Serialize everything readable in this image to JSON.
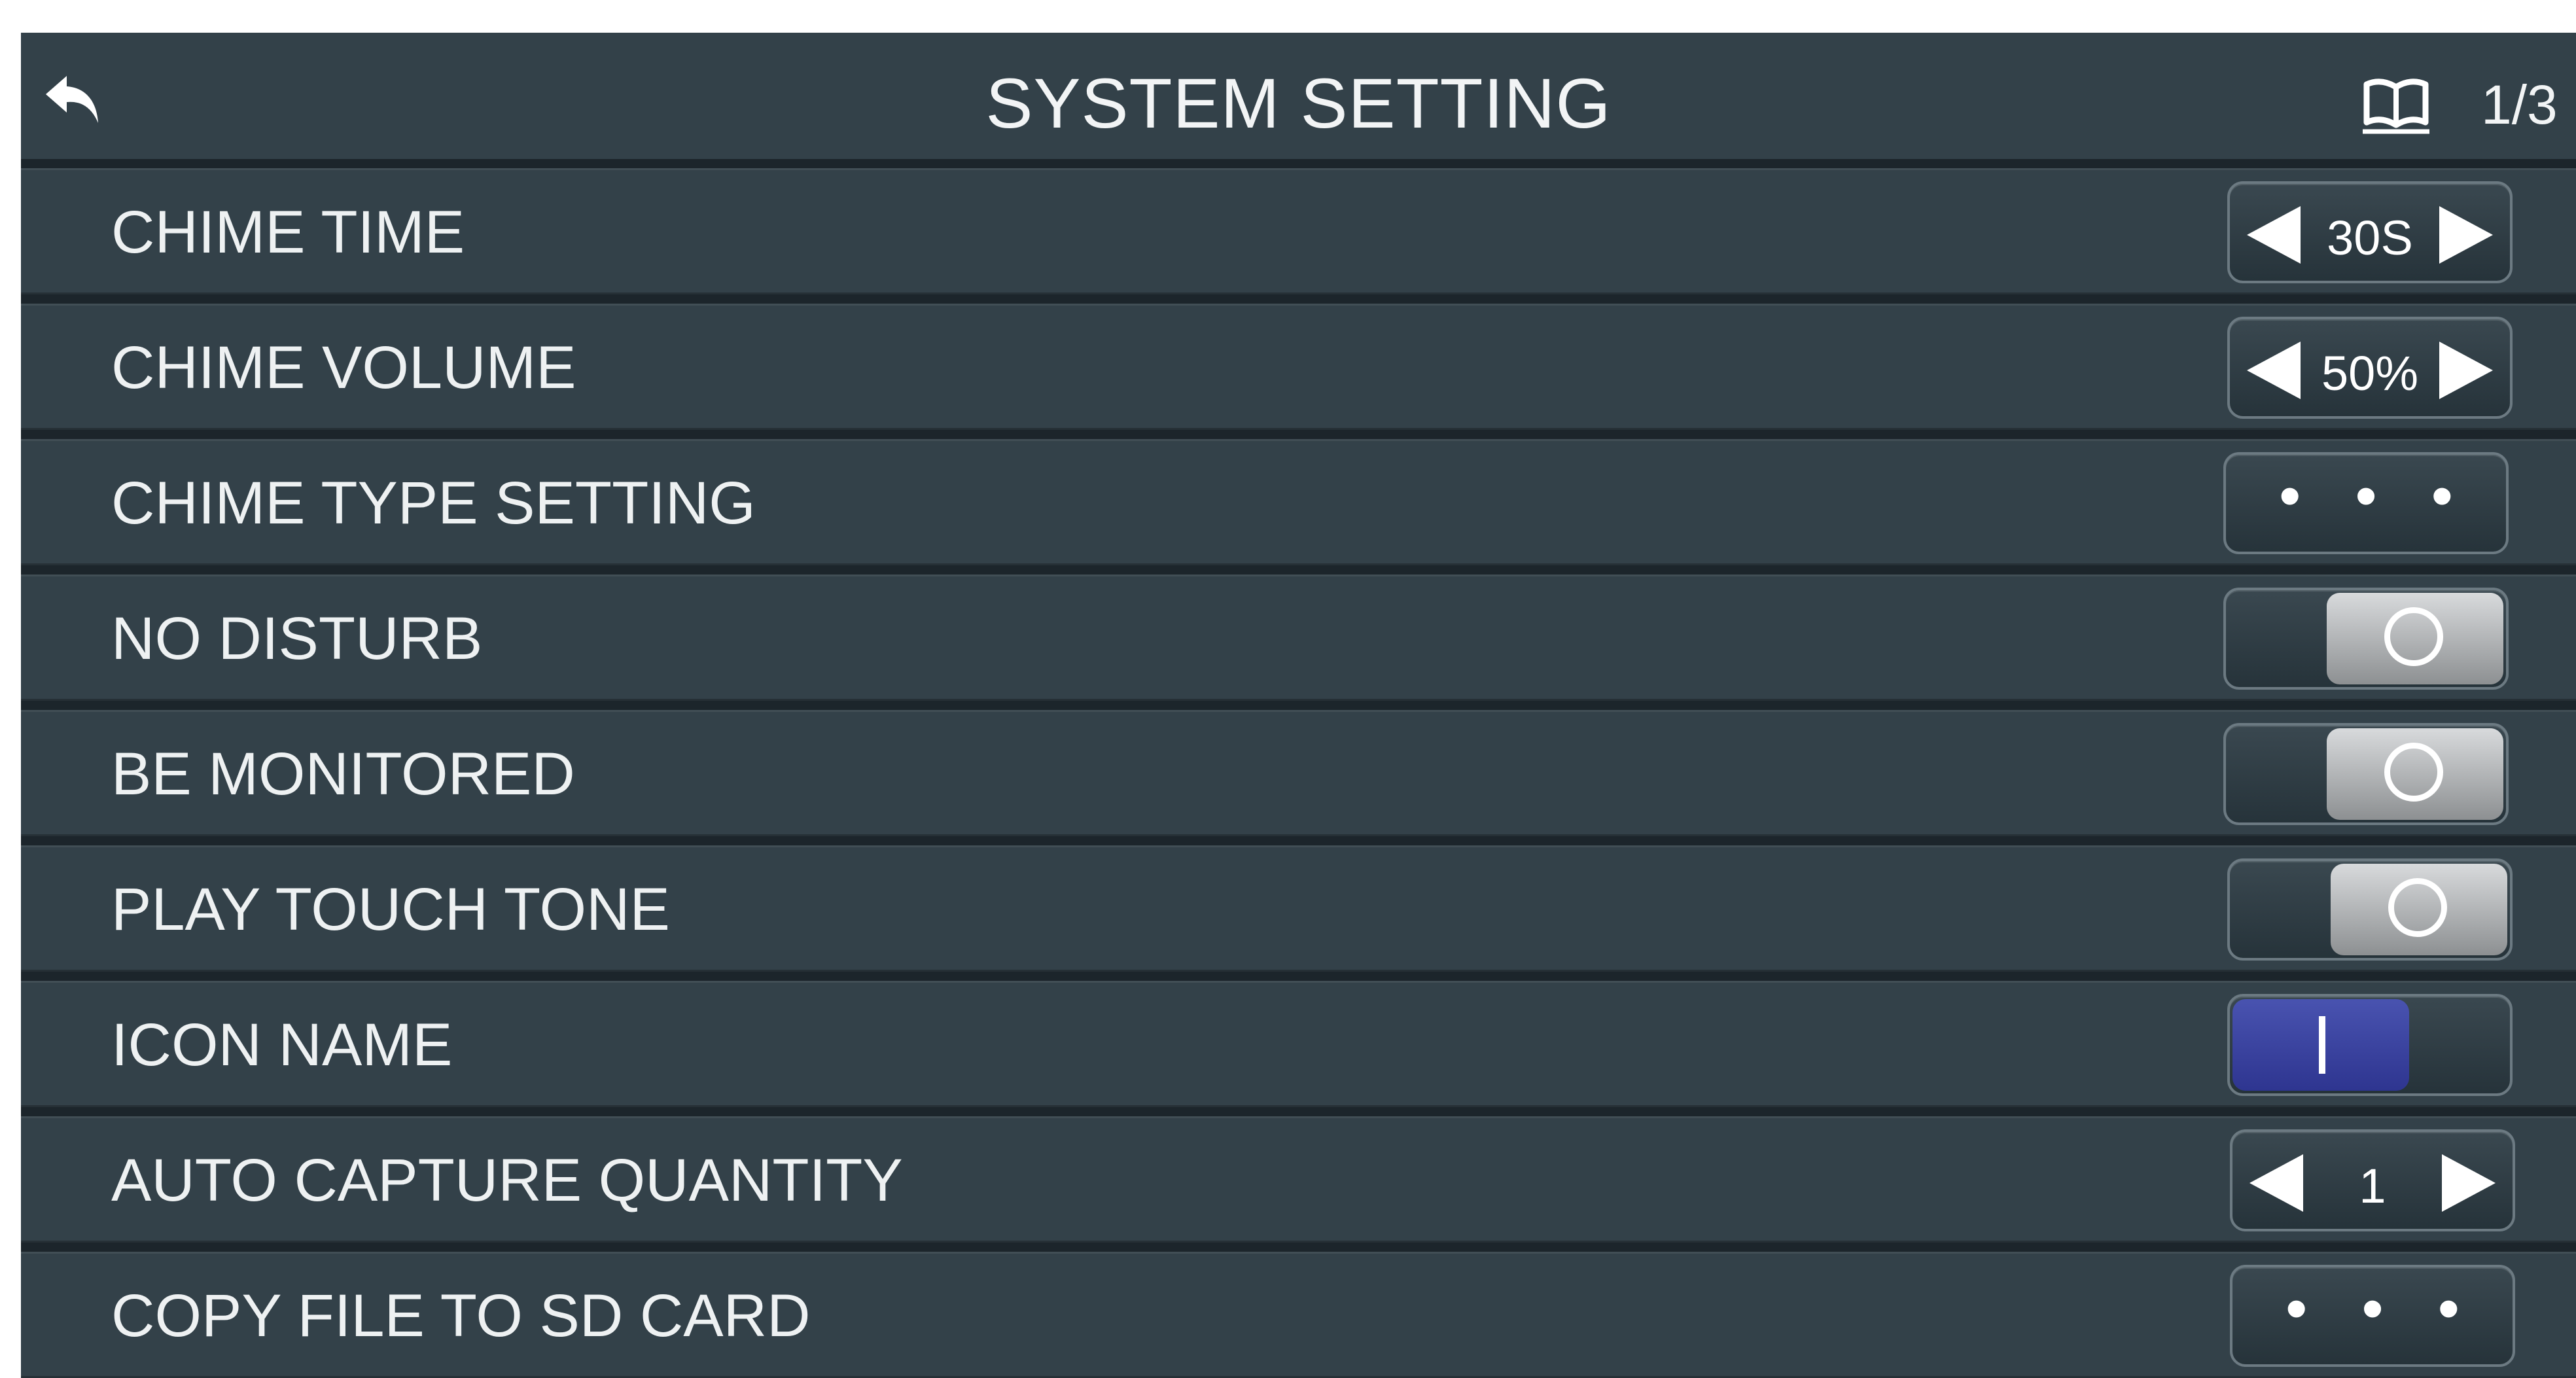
{
  "header": {
    "title": "SYSTEM SETTING",
    "back_icon": "back-arrow-icon",
    "book_icon": "open-book-icon",
    "page_indicator": "1/3"
  },
  "colors": {
    "background": "#1c252b",
    "row": "#334149",
    "toggle_on": "#3a43a8",
    "toggle_off_knob": "#bfc2c4",
    "text": "#eef1f2"
  },
  "settings": [
    {
      "label": "CHIME TIME",
      "control": "stepper",
      "value": "30S"
    },
    {
      "label": "CHIME VOLUME",
      "control": "stepper",
      "value": "50%"
    },
    {
      "label": "CHIME TYPE SETTING",
      "control": "more",
      "value": "• • •"
    },
    {
      "label": "NO DISTURB",
      "control": "toggle",
      "state": "off"
    },
    {
      "label": "BE MONITORED",
      "control": "toggle",
      "state": "off"
    },
    {
      "label": "PLAY TOUCH TONE",
      "control": "toggle",
      "state": "off"
    },
    {
      "label": "ICON NAME",
      "control": "toggle",
      "state": "on"
    },
    {
      "label": "AUTO CAPTURE QUANTITY",
      "control": "stepper",
      "value": "1"
    },
    {
      "label": "COPY FILE TO SD CARD",
      "control": "more",
      "value": "• • •"
    }
  ]
}
